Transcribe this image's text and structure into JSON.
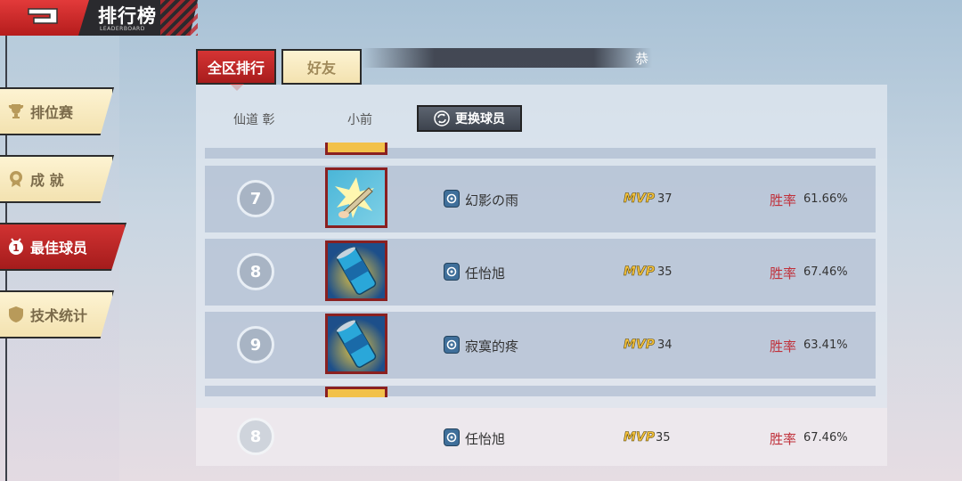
{
  "header": {
    "title": "排行榜",
    "subtitle": "LEADERBOARD"
  },
  "sidebar": {
    "items": [
      {
        "label": "排位赛",
        "icon": "trophy-icon",
        "active": false
      },
      {
        "label": "成 就",
        "icon": "medal-icon",
        "active": false
      },
      {
        "label": "最佳球员",
        "icon": "mvp-medal-icon",
        "active": true
      },
      {
        "label": "技术统计",
        "icon": "shield-icon",
        "active": false
      }
    ]
  },
  "tabs": [
    {
      "label": "全区排行",
      "active": true
    },
    {
      "label": "好友",
      "active": false
    }
  ],
  "banner": {
    "text": "恭"
  },
  "columns": {
    "player1": "仙道 彰",
    "player2": "小前",
    "switch_button": "更换球员"
  },
  "rows": [
    {
      "rank": "7",
      "item": "fan-item",
      "name": "幻影の雨",
      "mvp_label": "MVP",
      "mvp": "37",
      "win_label": "胜率",
      "win_rate": "61.66%"
    },
    {
      "rank": "8",
      "item": "drink-can-item",
      "name": "任怡旭",
      "mvp_label": "MVP",
      "mvp": "35",
      "win_label": "胜率",
      "win_rate": "67.46%"
    },
    {
      "rank": "9",
      "item": "drink-can-item",
      "name": "寂寞的疼",
      "mvp_label": "MVP",
      "mvp": "34",
      "win_label": "胜率",
      "win_rate": "63.41%"
    }
  ],
  "my_rank": {
    "rank": "8",
    "name": "任怡旭",
    "mvp_label": "MVP",
    "mvp": "35",
    "win_label": "胜率",
    "win_rate": "67.46%"
  },
  "colors": {
    "accent_red": "#c1272d",
    "tab_cream": "#f3e2b0",
    "mvp_gold": "#f6c23a"
  }
}
